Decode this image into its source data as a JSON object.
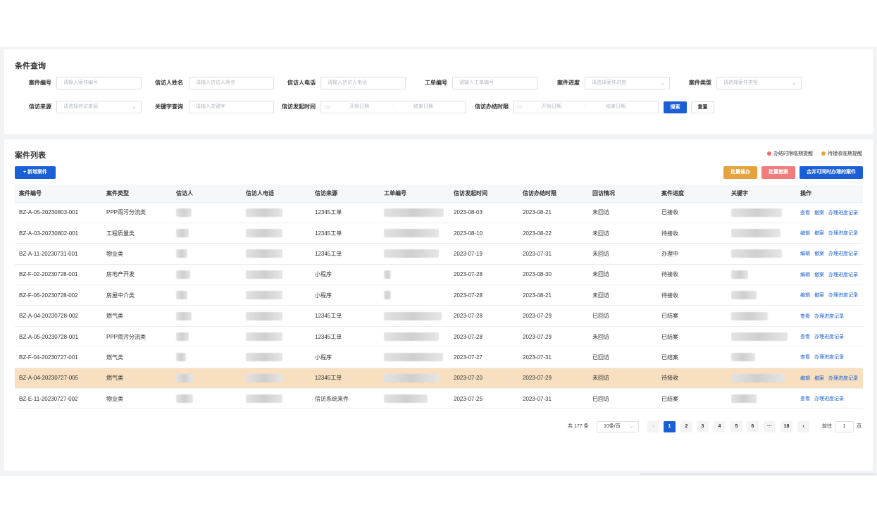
{
  "query": {
    "title": "条件查询",
    "fields": [
      {
        "label": "案件编号",
        "placeholder": "请输入案件编号"
      },
      {
        "label": "信访人姓名",
        "placeholder": "请输入信访人姓名"
      },
      {
        "label": "信访人电话",
        "placeholder": "请输入信访人电话"
      },
      {
        "label": "工单编号",
        "placeholder": "请输入工单编号"
      },
      {
        "label": "案件进度",
        "placeholder": "请选择案件进度"
      },
      {
        "label": "案件类型",
        "placeholder": "请选择案件类型"
      },
      {
        "label": "信访来源",
        "placeholder": "请选择信访来源"
      },
      {
        "label": "关键字查询",
        "placeholder": "请输入关键字"
      },
      {
        "label": "信访发起时间",
        "start": "开始日期",
        "sep": "-",
        "end": "结束日期"
      },
      {
        "label": "信访办结时限",
        "start": "开始日期",
        "sep": "-",
        "end": "结束日期"
      }
    ],
    "search_label": "搜索",
    "reset_label": "重置"
  },
  "list": {
    "title": "案件列表",
    "legend": [
      "办结时限临期提醒",
      "待接收临期提醒"
    ],
    "legend_colors": [
      "#f56c6c",
      "#e6a23c"
    ],
    "add_label": "+ 新增案件",
    "batch_urge_label": "批量催办",
    "batch_withdraw_label": "批量撤案",
    "merge_label": "合并可同时办理的案件",
    "columns": [
      "案件编号",
      "案件类型",
      "信访人",
      "信访人电话",
      "信访来源",
      "工单编号",
      "信访发起时间",
      "信访办结时限",
      "回访情况",
      "案件进度",
      "关键字",
      "操作"
    ],
    "rows": [
      {
        "id": "BZ-A-05-20230803-001",
        "type": "PPP雨污分流类",
        "source": "12345工单",
        "start": "2023-08-03",
        "deadline": "2023-08-21",
        "visit": "未回访",
        "progress": "已接收",
        "actions": [
          "查看",
          "撤案",
          "办理进度记录"
        ]
      },
      {
        "id": "BZ-A-03-20230802-001",
        "type": "工程质量类",
        "source": "12345工单",
        "start": "2023-08-10",
        "deadline": "2023-08-22",
        "visit": "未回访",
        "progress": "待接收",
        "actions": [
          "编辑",
          "撤案",
          "办理进度记录"
        ]
      },
      {
        "id": "BZ-A-11-20230731-001",
        "type": "物业类",
        "source": "12345工单",
        "start": "2023-07-19",
        "deadline": "2023-07-31",
        "visit": "未回访",
        "progress": "办理中",
        "actions": [
          "编辑",
          "撤案",
          "办理进度记录"
        ]
      },
      {
        "id": "BZ-F-02-20230728-001",
        "type": "房地产开发",
        "source": "小程序",
        "start": "2023-07-28",
        "deadline": "2023-08-30",
        "visit": "未回访",
        "progress": "待接收",
        "actions": [
          "编辑",
          "撤案",
          "办理进度记录"
        ]
      },
      {
        "id": "BZ-F-06-20230728-002",
        "type": "房屋中介类",
        "source": "小程序",
        "start": "2023-07-28",
        "deadline": "2023-08-21",
        "visit": "未回访",
        "progress": "待接收",
        "actions": [
          "编辑",
          "撤案",
          "办理进度记录"
        ]
      },
      {
        "id": "BZ-A-04-20230728-002",
        "type": "燃气类",
        "source": "12345工单",
        "start": "2023-07-28",
        "deadline": "2023-07-29",
        "visit": "已回访",
        "progress": "已结案",
        "actions": [
          "查看",
          "办理进度记录"
        ]
      },
      {
        "id": "BZ-A-05-20230728-001",
        "type": "PPP雨污分流类",
        "source": "12345工单",
        "start": "2023-07-28",
        "deadline": "2023-07-29",
        "visit": "未回访",
        "progress": "已结案",
        "actions": [
          "查看",
          "办理进度记录"
        ]
      },
      {
        "id": "BZ-F-04-20230727-001",
        "type": "燃气类",
        "source": "小程序",
        "start": "2023-07-27",
        "deadline": "2023-07-31",
        "visit": "已回访",
        "progress": "已结案",
        "actions": [
          "查看",
          "办理进度记录"
        ]
      },
      {
        "id": "BZ-A-04-20230727-005",
        "type": "燃气类",
        "source": "12345工单",
        "start": "2023-07-20",
        "deadline": "2023-07-29",
        "visit": "未回访",
        "progress": "待接收",
        "actions": [
          "编辑",
          "撤案",
          "办理进度记录"
        ]
      },
      {
        "id": "BZ-E-11-20230727-002",
        "type": "物业类",
        "source": "信访系统来件",
        "start": "2023-07-25",
        "deadline": "2023-07-31",
        "visit": "已回访",
        "progress": "已结案",
        "actions": [
          "查看",
          "办理进度记录"
        ]
      }
    ],
    "highlight_row": 8
  },
  "pagination": {
    "total_label": "共 177 条",
    "page_size": "10条/页",
    "prev": "‹",
    "pages": [
      "1",
      "2",
      "3",
      "4",
      "5",
      "6",
      "···",
      "18"
    ],
    "next": "›",
    "goto_label": "前往",
    "goto_value": "1",
    "page_unit": "页"
  }
}
